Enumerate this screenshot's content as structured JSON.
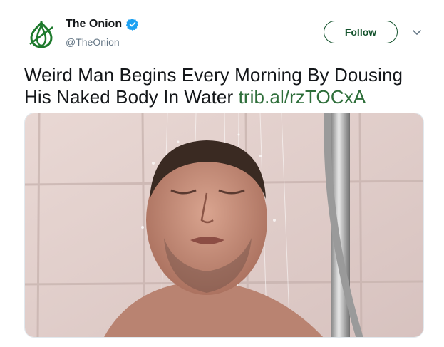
{
  "tweet": {
    "author": {
      "display_name": "The Onion",
      "handle": "@TheOnion",
      "verified": true,
      "avatar_icon": "onion-logo-icon",
      "brand_color": "#1d7a2c"
    },
    "follow_label": "Follow",
    "menu_icon": "chevron-down-icon",
    "text": "Weird Man Begins Every Morning By Dousing His Naked Body In Water",
    "link_text": "trib.al/rzTOCxA",
    "link_color": "#2e6e3a",
    "media": {
      "subject": "shower-photo"
    }
  }
}
